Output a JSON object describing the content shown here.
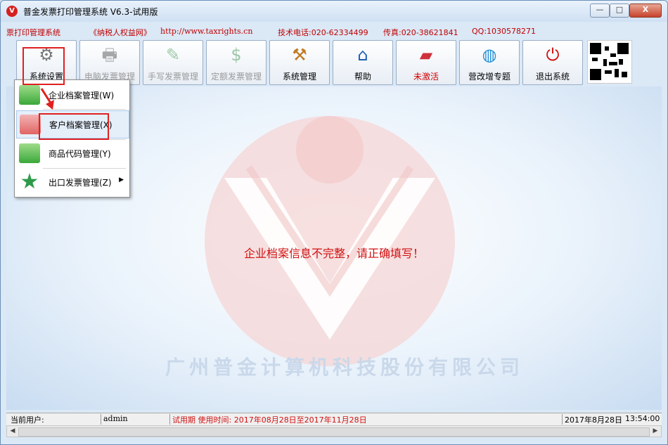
{
  "window": {
    "title": "普金发票打印管理系统 V6.3-试用版",
    "app_icon": "V",
    "controls": {
      "minimize": "—",
      "maximize": "□",
      "close": "X"
    }
  },
  "infobar": {
    "system_name": "票打印管理系统",
    "site_name": "《纳税人权益网》",
    "url": "http://www.taxrights.cn",
    "tech_phone": "技术电话:020-62334499",
    "fax": "传真:020-38621841",
    "qq": "QQ:1030578271"
  },
  "toolbar": {
    "buttons": [
      {
        "label": "系统设置",
        "icon": "gears-icon",
        "glyph": "⚙"
      },
      {
        "label": "电脑发票管理",
        "icon": "printer-icon",
        "glyph": "🖶"
      },
      {
        "label": "手写发票管理",
        "icon": "handwrite-icon",
        "glyph": "✎"
      },
      {
        "label": "定额发票管理",
        "icon": "fixed-invoice-icon",
        "glyph": "$"
      },
      {
        "label": "系统管理",
        "icon": "tools-icon",
        "glyph": "⚒"
      },
      {
        "label": "帮助",
        "icon": "home-icon",
        "glyph": "⌂"
      },
      {
        "label": "未激活",
        "icon": "usb-key-icon",
        "glyph": "▰"
      },
      {
        "label": "营改增专题",
        "icon": "globe-icon",
        "glyph": "◍"
      },
      {
        "label": "退出系统",
        "icon": "power-icon",
        "glyph": "⏻"
      }
    ]
  },
  "menu": {
    "items": [
      {
        "label": "企业档案管理(W)",
        "icon": "enterprise-book-icon",
        "color": "#3aa83a"
      },
      {
        "label": "客户档案管理(X)",
        "icon": "customer-book-icon",
        "color": "#e06565"
      },
      {
        "label": "商品代码管理(Y)",
        "icon": "product-book-icon",
        "color": "#3aa83a"
      },
      {
        "label": "出口发票管理(Z)",
        "icon": "star-icon",
        "color": "#2d9a4a",
        "submenu_arrow": "▶"
      }
    ]
  },
  "main": {
    "message": "企业档案信息不完整，请正确填写！",
    "watermark": "广州普金计算机科技股份有限公司"
  },
  "status": {
    "user_label": "当前用户:",
    "user": "admin",
    "trial": "试用期  使用时间: 2017年08月28日至2017年11月28日",
    "date": "2017年8月28日",
    "time": "13:54:00"
  },
  "colors": {
    "accent_red": "#d01010",
    "highlight_box": "#e02020"
  }
}
